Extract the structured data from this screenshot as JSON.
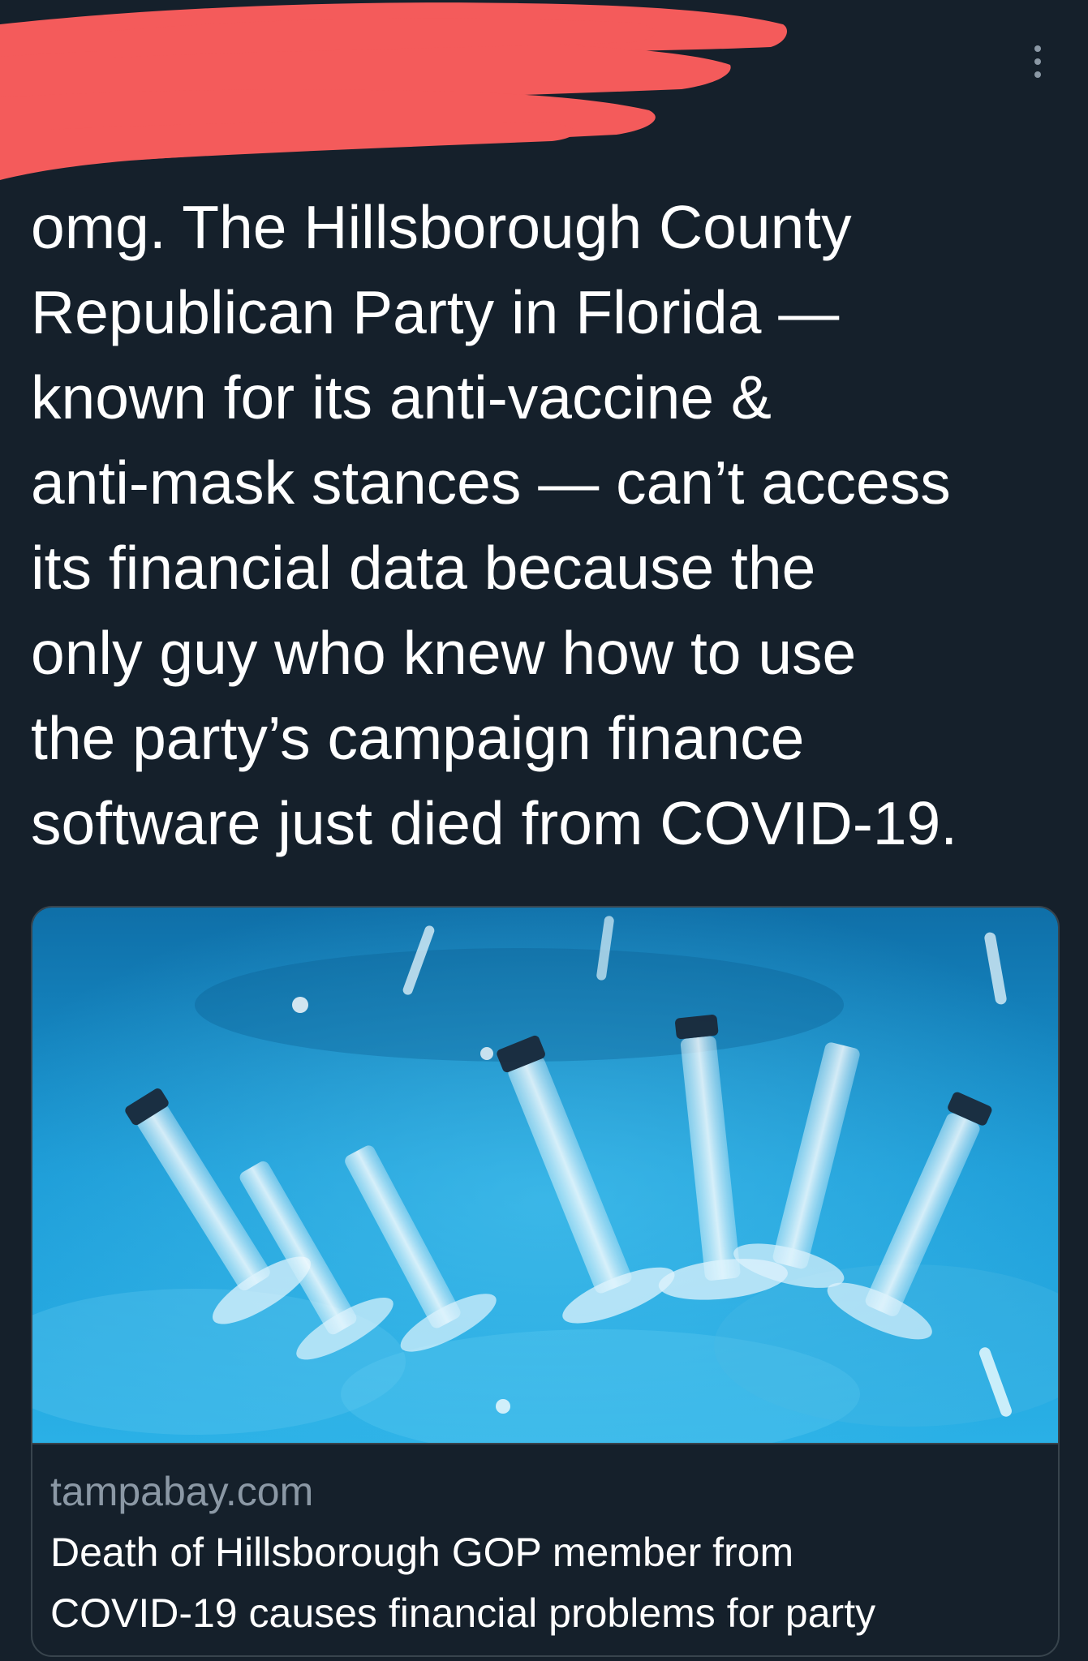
{
  "header": {
    "redacted_author": true,
    "more_icon": "more-vertical-icon"
  },
  "tweet": {
    "text_lines": [
      "omg. The Hillsborough County",
      "Republican Party in Florida —",
      "known for its anti-vaccine &",
      "anti-mask stances — can’t access",
      "its financial data because the",
      "only guy who knew how to use",
      "the party’s campaign finance",
      "software just died from COVID-19."
    ]
  },
  "link_card": {
    "image": "syringes-photo",
    "domain": "tampabay.com",
    "title_lines": [
      "Death of Hillsborough GOP member from",
      "COVID-19 causes financial problems for party"
    ]
  },
  "colors": {
    "background": "#15202b",
    "text": "#ffffff",
    "secondary_text": "#8b98a5",
    "border": "#38444d",
    "redaction": "#f45b5b"
  }
}
